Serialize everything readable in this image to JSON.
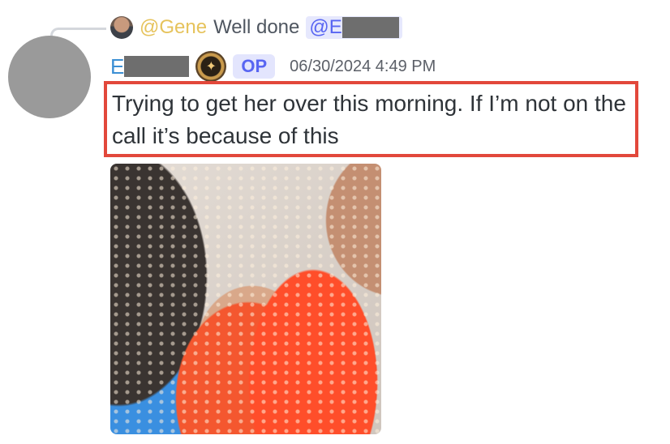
{
  "reply": {
    "author": "@Gene",
    "text": "Well done",
    "mention": "@E"
  },
  "message": {
    "username": "E",
    "op_tag": "OP",
    "timestamp": "06/30/2024 4:49 PM",
    "text": "Trying to get her over this morning. If I’m not on the call it’s because of this",
    "badge_icon": "achievement-badge-icon"
  },
  "colors": {
    "highlight_border": "#e2483b",
    "username": "#3b8fd4",
    "reply_author": "#e6c35c",
    "mention": "#5865f2"
  }
}
